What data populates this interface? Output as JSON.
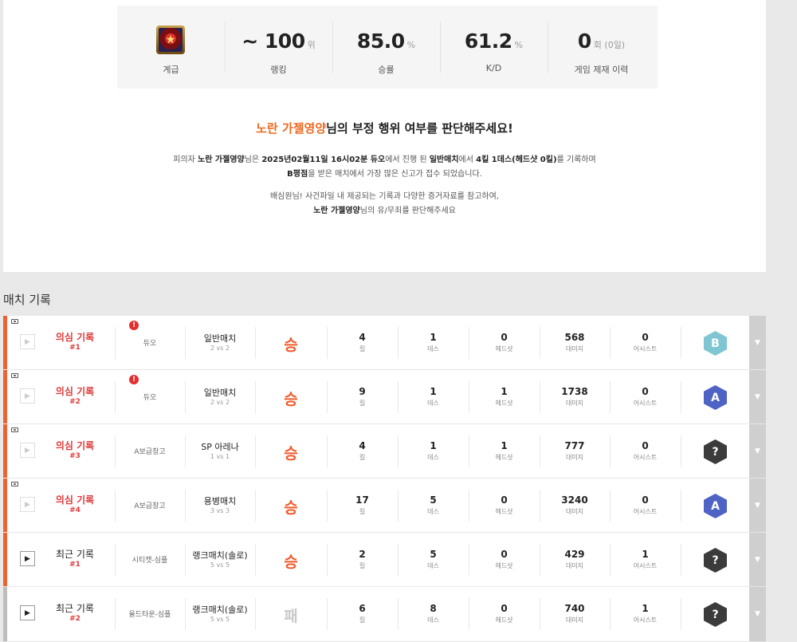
{
  "stats": {
    "tier_label": "계급",
    "ranking": {
      "value": "~ 100",
      "unit": "위",
      "label": "랭킹"
    },
    "winrate": {
      "value": "85.0",
      "unit": "%",
      "label": "승률"
    },
    "kd": {
      "value": "61.2",
      "unit": "%",
      "label": "K/D"
    },
    "sanction": {
      "value": "0",
      "unit": "회 (0일)",
      "label": "게임 제재 이력"
    }
  },
  "headline": {
    "name": "노란 가젤영양",
    "rest": "님의 부정 행위 여부를 판단해주세요!"
  },
  "description": {
    "l1_a": "피의자 ",
    "l1_name": "노란 가젤영양",
    "l1_b": "님은 ",
    "l1_date": "2025년02월11일 16시02분 듀오",
    "l1_c": "에서 진행 된 ",
    "l1_match": "일반매치",
    "l1_d": "에서 ",
    "l1_kd": "4킬 1데스(헤드샷 0킬)",
    "l1_e": "를 기록하며",
    "l2_grade": "B평점",
    "l2_rest": "을 받은 매치에서 가장 많은 신고가 접수 되었습니다.",
    "l3": "배심원님! 사건파일 내 제공되는 기록과 다양한 증거자료를 참고하여,",
    "l4_name": "노란 가젤영양",
    "l4_rest": "님의 유/무죄를 판단해주세요"
  },
  "section_title": "매치 기록",
  "stat_labels": {
    "kill": "킬",
    "death": "데스",
    "headshot": "헤드샷",
    "damage": "대미지",
    "assist": "어시스트"
  },
  "matches": [
    {
      "type": "의심 기록",
      "num": "#1",
      "suspect": true,
      "alert": "!",
      "mode": "듀오",
      "match": "일반매치",
      "size": "2 vs 2",
      "result": "승",
      "kills": "4",
      "deaths": "1",
      "headshots": "0",
      "damage": "568",
      "assists": "0",
      "grade": "B"
    },
    {
      "type": "의심 기록",
      "num": "#2",
      "suspect": true,
      "alert": "!",
      "mode": "듀오",
      "match": "일반매치",
      "size": "2 vs 2",
      "result": "승",
      "kills": "9",
      "deaths": "1",
      "headshots": "1",
      "damage": "1738",
      "assists": "0",
      "grade": "A"
    },
    {
      "type": "의심 기록",
      "num": "#3",
      "suspect": true,
      "mode": "A보급창고",
      "match": "SP 아레나",
      "size": "1 vs 1",
      "result": "승",
      "kills": "4",
      "deaths": "1",
      "headshots": "1",
      "damage": "777",
      "assists": "0",
      "grade": "?"
    },
    {
      "type": "의심 기록",
      "num": "#4",
      "suspect": true,
      "mode": "A보급창고",
      "match": "용병매치",
      "size": "3 vs 3",
      "result": "승",
      "kills": "17",
      "deaths": "5",
      "headshots": "0",
      "damage": "3240",
      "assists": "0",
      "grade": "A"
    },
    {
      "type": "최근 기록",
      "num": "#1",
      "suspect": false,
      "mode": "시티캣-심플",
      "match": "랭크매치(솔로)",
      "size": "5 vs 5",
      "result": "승",
      "kills": "2",
      "deaths": "5",
      "headshots": "0",
      "damage": "429",
      "assists": "1",
      "grade": "?"
    },
    {
      "type": "최근 기록",
      "num": "#2",
      "suspect": false,
      "mode": "올드타운-심플",
      "match": "랭크매치(솔로)",
      "size": "5 vs 5",
      "result": "패",
      "kills": "6",
      "deaths": "8",
      "headshots": "0",
      "damage": "740",
      "assists": "1",
      "grade": "?"
    }
  ],
  "colors": {
    "accent": "#ee6820",
    "suspect_red": "#e03b3b",
    "win": "#ee5b2c",
    "lose": "#c8c8c8",
    "grade_B": "#7fc6d2",
    "grade_A": "#4e63c4",
    "grade_unknown": "#3b3b3b"
  },
  "icons": {
    "play": "play-icon",
    "camera": "camera-icon",
    "expand": "chevron-down-icon",
    "alert": "alert-icon",
    "tier": "tier-emblem"
  }
}
